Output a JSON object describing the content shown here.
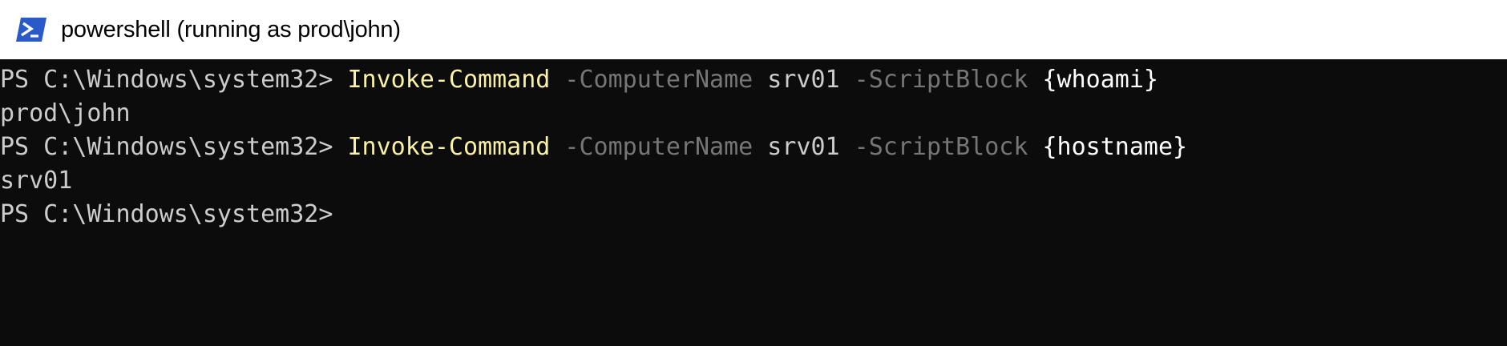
{
  "window": {
    "title": "powershell (running as prod\\john)",
    "icon": "powershell-icon"
  },
  "colors": {
    "console_bg": "#0c0c0c",
    "text": "#cccccc",
    "cmdlet": "#f9f1a5",
    "parameter": "#767676",
    "scriptblock": "#ffffff",
    "icon_blue": "#2a5ac8"
  },
  "console": {
    "lines": [
      {
        "prompt": "PS C:\\Windows\\system32> ",
        "cmdlet": "Invoke-Command",
        "param1": " -ComputerName",
        "arg1": " srv01",
        "param2": " -ScriptBlock",
        "block": " {whoami}"
      },
      {
        "output": "prod\\john"
      },
      {
        "prompt": "PS C:\\Windows\\system32> ",
        "cmdlet": "Invoke-Command",
        "param1": " -ComputerName",
        "arg1": " srv01",
        "param2": " -ScriptBlock",
        "block": " {hostname}"
      },
      {
        "output": "srv01"
      },
      {
        "prompt": "PS C:\\Windows\\system32>"
      }
    ]
  }
}
